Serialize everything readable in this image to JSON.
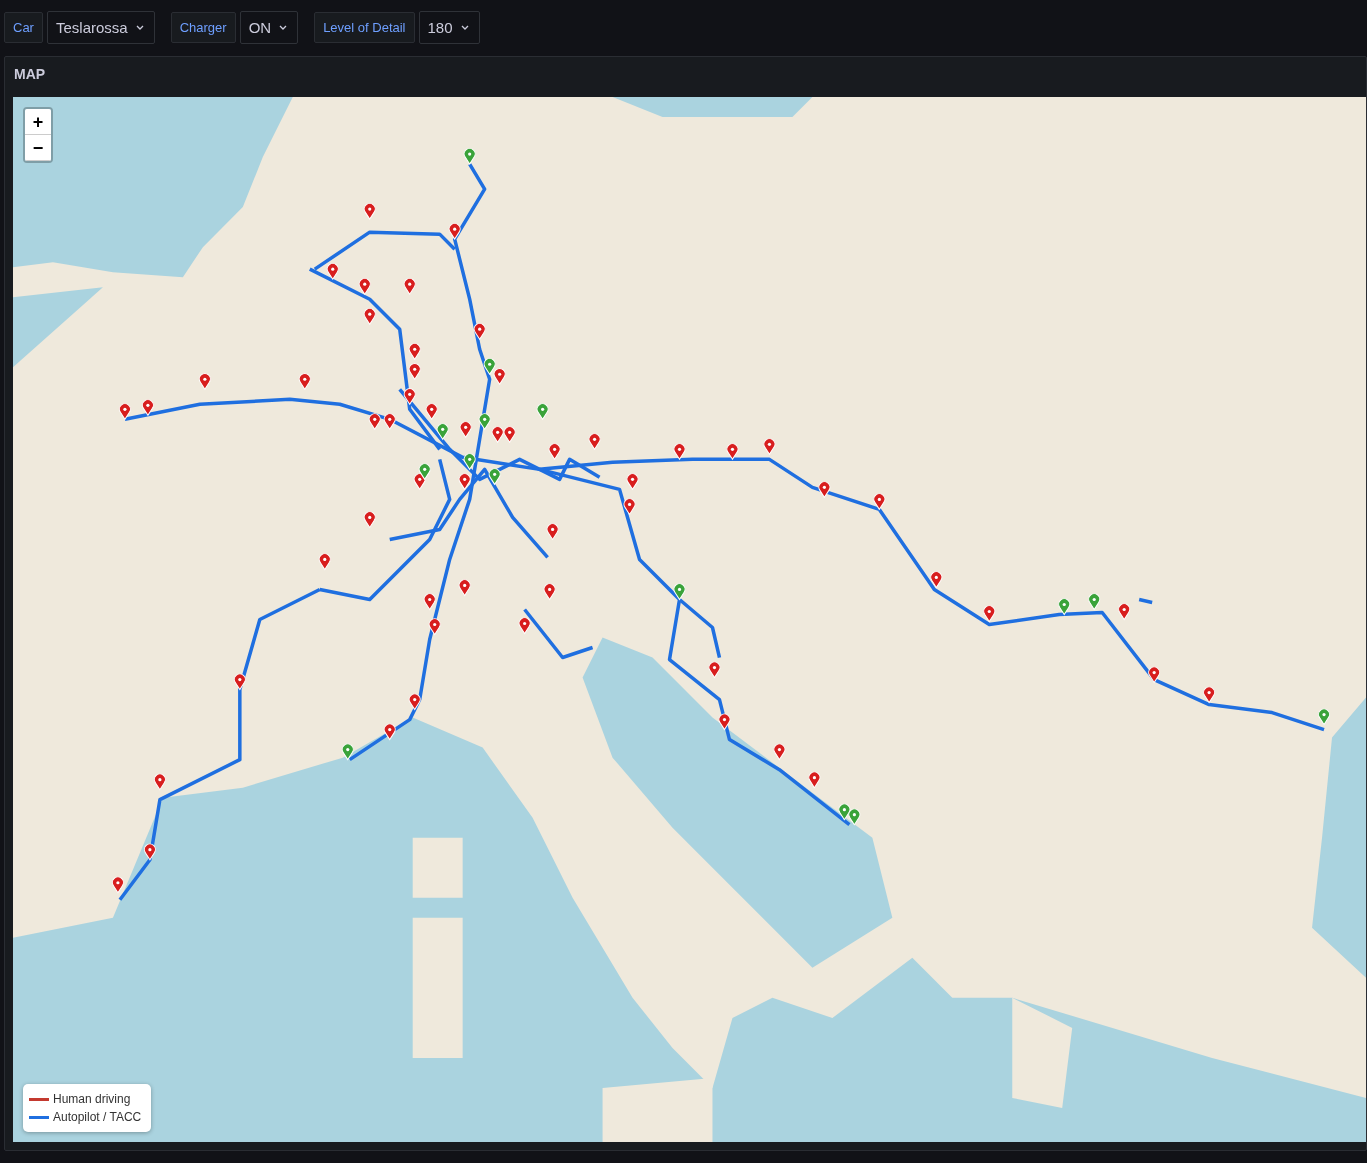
{
  "variables": [
    {
      "label": "Car",
      "value": "Teslarossa"
    },
    {
      "label": "Charger",
      "value": "ON"
    },
    {
      "label": "Level of Detail",
      "value": "180"
    }
  ],
  "panel": {
    "title": "MAP",
    "zoom_controls": [
      "+",
      "−"
    ],
    "legend": [
      {
        "label": "Human driving",
        "color": "#c4392f"
      },
      {
        "label": "Autopilot / TACC",
        "color": "#1f6fe0"
      }
    ]
  }
}
